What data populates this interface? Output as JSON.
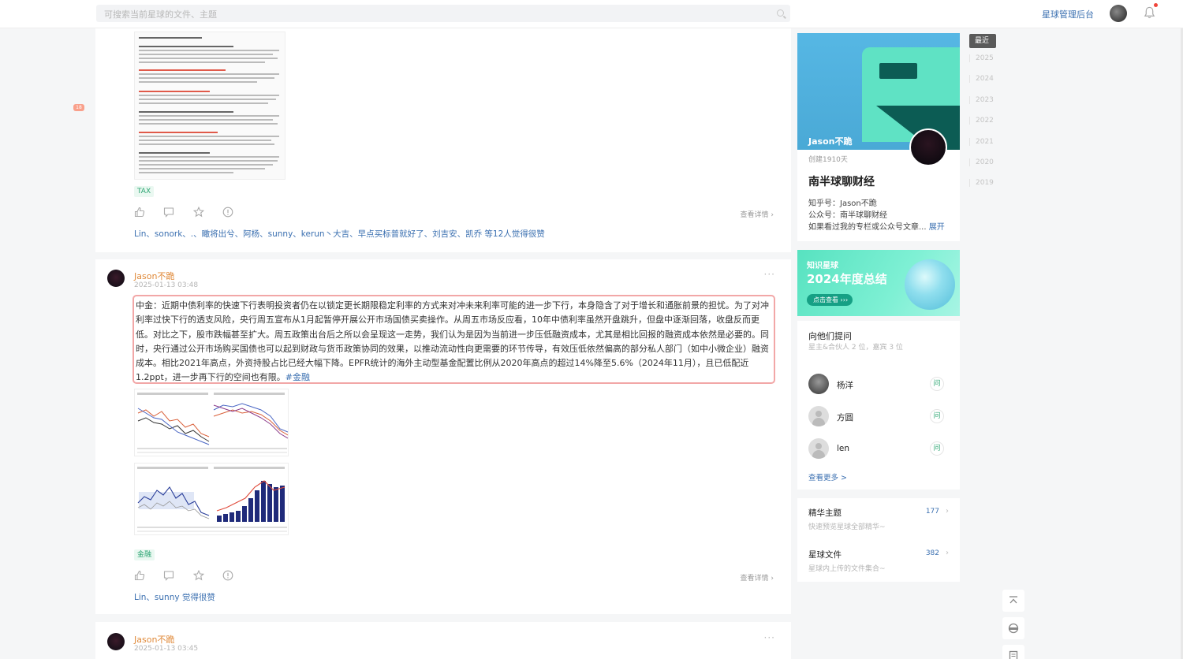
{
  "topbar": {
    "search_placeholder": "可搜索当前星球的文件、主题",
    "admin_label": "星球管理后台"
  },
  "left_badge": "18",
  "post1": {
    "tag": "TAX",
    "detail": "查看详情 ›",
    "likers": "Lin、sonork、.、瞰将出兮、阿杨、sunny、kerun丶大吉、早点买标普就好了、刘吉安、凯乔",
    "likers_tail": " 等12人觉得很赞"
  },
  "post2": {
    "author": "Jason不跪",
    "time": "2025-01-13 03:48",
    "more": "···",
    "text": "中金：近期中债利率的快速下行表明投资者仍在以锁定更长期限稳定利率的方式来对冲未来利率可能的进一步下行，本身隐含了对于增长和通胀前景的担忧。为了对冲利率过快下行的透支风险，央行周五宣布从1月起暂停开展公开市场国债买卖操作。从周五市场反应看，10年中债利率虽然开盘跳升，但盘中逐渐回落，收盘反而更低。对比之下，股市跌幅甚至扩大。周五政策出台后之所以会呈现这一走势，我们认为是因为当前进一步压低融资成本，尤其是相比回报的融资成本依然是必要的。同时，央行通过公开市场购买国债也可以起到财政与货币政策协同的效果，以推动流动性向更需要的环节传导，有效压低依然偏高的部分私人部门（如中小微企业）融资成本。相比2021年高点，外资持股占比已经大幅下降。EPFR统计的海外主动型基金配置比例从2020年高点的超过14%降至5.6%（2024年11月），且已低配近1.2ppt，进一步再下行的空间也有限。",
    "hashtag": "#金融",
    "tag": "金融",
    "detail": "查看详情 ›",
    "likers": "Lin、sunny 觉得很赞"
  },
  "post3": {
    "author": "Jason不跪",
    "time": "2025-01-13 03:45",
    "more": "···"
  },
  "profile": {
    "cover_name": "Jason不跪",
    "created": "创建1910天",
    "planet_name": "南半球聊财经",
    "bio": [
      "知乎号：Jason不跪",
      "公众号：南半球聊财经",
      "如果看过我的专栏或公众号文章..."
    ],
    "expand": "展开"
  },
  "banner": {
    "line1": "知识星球",
    "line2": "2024年度总结",
    "button": "点击查看 ›››"
  },
  "ask": {
    "title": "向他们提问",
    "subtitle": "星主&合伙人 2 位，嘉宾 3 位",
    "people": [
      {
        "name": "杨洋",
        "btn": "问"
      },
      {
        "name": "方圆",
        "btn": "问"
      },
      {
        "name": "len",
        "btn": "问"
      }
    ],
    "see_more": "查看更多 >"
  },
  "menu": [
    {
      "title": "精华主题",
      "subtitle": "快速预览星球全部精华~",
      "count": "177"
    },
    {
      "title": "星球文件",
      "subtitle": "星球内上传的文件集合~",
      "count": "382"
    }
  ],
  "years": {
    "active": "最近",
    "list": [
      "2025",
      "2024",
      "2023",
      "2022",
      "2021",
      "2020",
      "2019"
    ]
  },
  "icons": {
    "like": "thumbs-up-icon",
    "comment": "comment-icon",
    "star": "star-icon",
    "report": "exclamation-icon"
  }
}
